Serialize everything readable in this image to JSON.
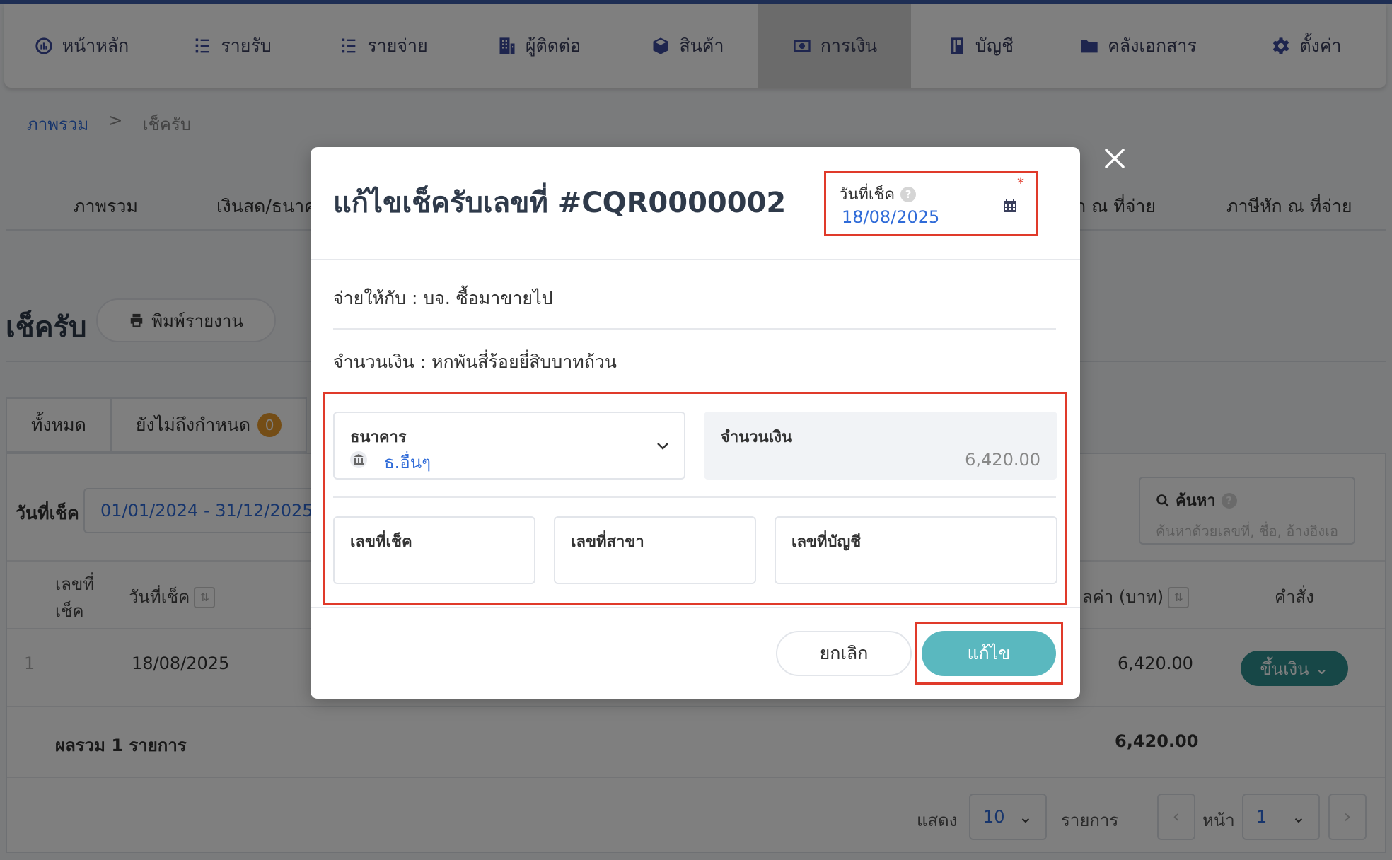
{
  "nav": {
    "items": [
      {
        "label": "หน้าหลัก",
        "icon": "dashboard-icon"
      },
      {
        "label": "รายรับ",
        "icon": "income-list-icon"
      },
      {
        "label": "รายจ่าย",
        "icon": "expense-list-icon"
      },
      {
        "label": "ผู้ติดต่อ",
        "icon": "contacts-building-icon"
      },
      {
        "label": "สินค้า",
        "icon": "product-box-icon"
      },
      {
        "label": "การเงิน",
        "icon": "money-icon"
      },
      {
        "label": "บัญชี",
        "icon": "account-book-icon"
      },
      {
        "label": "คลังเอกสาร",
        "icon": "folder-icon"
      },
      {
        "label": "ตั้งค่า",
        "icon": "gear-icon"
      }
    ]
  },
  "breadcrumb": {
    "root": "ภาพรวม",
    "separator": ">",
    "current": "เช็ครับ"
  },
  "subtabs": {
    "overview": "ภาพรวม",
    "cash_bank": "เงินสด/ธนาคา",
    "wht_paid_partial": "ัก ณ ที่จ่าย",
    "wht_paid": "ภาษีหัก ณ ที่จ่าย"
  },
  "page": {
    "title": "เช็ครับ",
    "print_button": "พิมพ์รายงาน"
  },
  "status_tabs": {
    "all": "ทั้งหมด",
    "not_due": "ยังไม่ถึงกำหนด",
    "not_due_count": "0"
  },
  "filters": {
    "date_label": "วันที่เช็ค",
    "date_range": "01/01/2024 - 31/12/2025",
    "search_label": "ค้นหา",
    "search_placeholder": "ค้นหาด้วยเลขที่, ชื่อ, อ้างอิงเอ"
  },
  "table": {
    "headers": {
      "no_line1": "เลขที่",
      "no_line2": "เช็ค",
      "date": "วันที่เช็ค",
      "amount": "ลค่า (บาท)",
      "action": "คำสั่ง"
    },
    "rows": [
      {
        "index": "1",
        "date": "18/08/2025",
        "amount": "6,420.00",
        "action": "ขึ้นเงิน"
      }
    ],
    "total_label": "ผลรวม 1 รายการ",
    "total_value": "6,420.00"
  },
  "pagination": {
    "show_label": "แสดง",
    "per_page": "10",
    "items_label": "รายการ",
    "page_label": "หน้า",
    "page": "1",
    "prev": "‹",
    "next": "›"
  },
  "modal": {
    "title": "แก้ไขเช็ครับเลขที่ #CQR0000002",
    "date_label": "วันที่เช็ค",
    "date_help": "?",
    "required_mark": "*",
    "date_value": "18/08/2025",
    "pay_to": "จ่ายให้กับ : บจ. ซื้อมาขายไป",
    "amount_text": "จำนวนเงิน : หกพันสี่ร้อยยี่สิบบาทถ้วน",
    "bank_label": "ธนาคาร",
    "bank_value": "ธ.อื่นๆ",
    "amount_label": "จำนวนเงิน",
    "amount_value": "6,420.00",
    "check_no_label": "เลขที่เช็ค",
    "check_no_value": "",
    "branch_no_label": "เลขที่สาขา",
    "branch_no_value": "",
    "account_no_label": "เลขที่บัญชี",
    "account_no_value": "",
    "cancel_button": "ยกเลิก",
    "save_button": "แก้ไข"
  },
  "colors": {
    "accent": "#2f6bd8",
    "highlight": "#e03a2a",
    "save_button": "#5ab8bf",
    "action_button": "#2e8f8f",
    "badge": "#e89a2c"
  }
}
